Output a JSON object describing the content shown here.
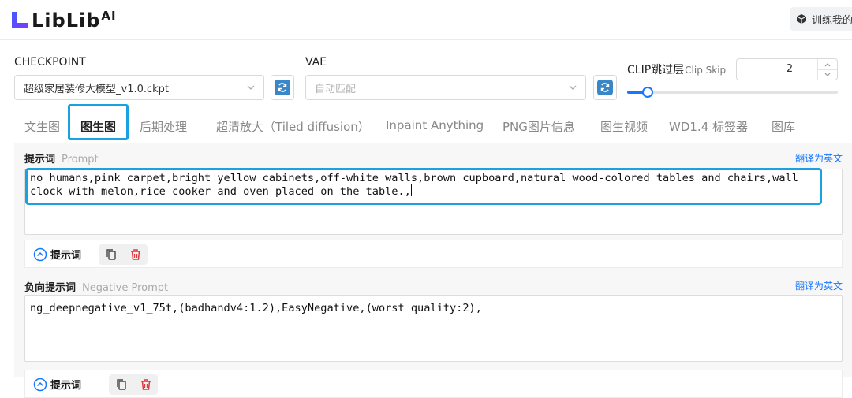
{
  "header": {
    "logo_text": "LibLib",
    "logo_suffix": "AI",
    "train_label": "训练我的",
    "brand_colors": [
      "#3f5bff",
      "#7a3cff"
    ]
  },
  "controls": {
    "checkpoint": {
      "label": "CHECKPOINT",
      "value": "超级家居装修大模型_v1.0.ckpt"
    },
    "vae": {
      "label": "VAE",
      "placeholder": "自动匹配"
    },
    "clip": {
      "label": "CLIP跳过层",
      "label_en": "Clip Skip",
      "value": "2",
      "slider_fraction": 0.09
    }
  },
  "tabs": [
    {
      "label": "文生图"
    },
    {
      "label": "图生图",
      "active": true
    },
    {
      "label": "后期处理"
    },
    {
      "label": "超清放大（Tiled diffusion）"
    },
    {
      "label": "Inpaint Anything"
    },
    {
      "label": "PNG图片信息"
    },
    {
      "label": "图生视频"
    },
    {
      "label": "WD1.4 标签器"
    },
    {
      "label": "图库"
    }
  ],
  "prompt": {
    "title": "提示词",
    "title_en": "Prompt",
    "translate": "翻译为英文",
    "text": "no humans,pink carpet,bright yellow cabinets,off-white walls,brown cupboard,natural wood-colored tables and chairs,wall clock with melon,rice cooker and oven placed on the table.,",
    "toggle_label": "提示词"
  },
  "negative": {
    "title": "负向提示词",
    "title_en": "Negative Prompt",
    "translate": "翻译为英文",
    "text": "ng_deepnegative_v1_75t,(badhandv4:1.2),EasyNegative,(worst quality:2),",
    "toggle_label": "提示词"
  },
  "colors": {
    "accent": "#1677ff",
    "highlight": "#1ba1e2",
    "delete": "#e0393e"
  }
}
